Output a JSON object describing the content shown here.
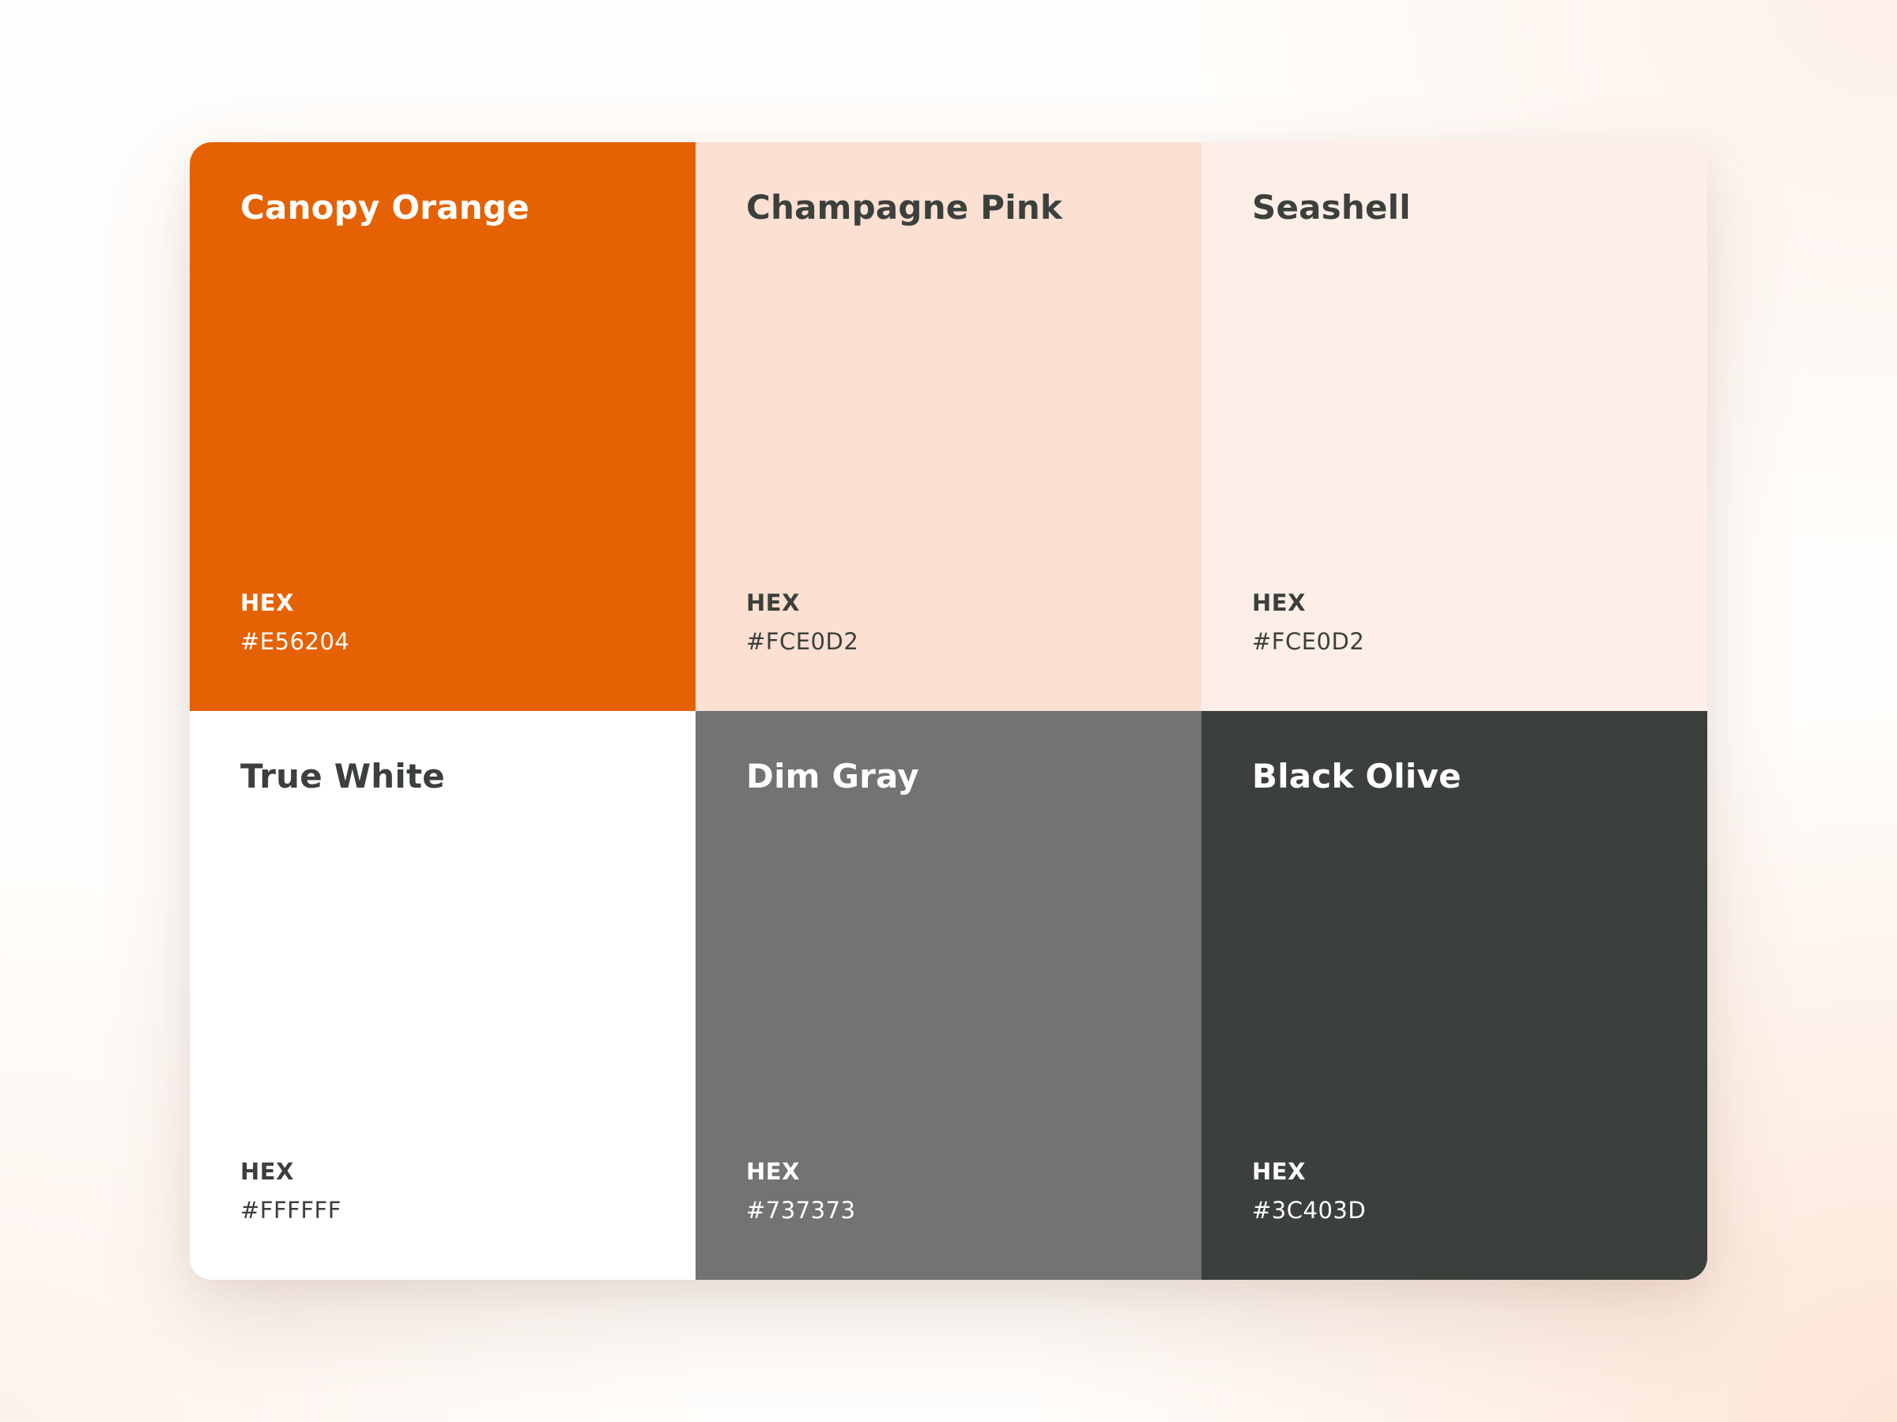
{
  "swatches": [
    {
      "name": "Canopy Orange",
      "hex_label": "HEX",
      "hex": "#E56204",
      "background": "#E56204",
      "text_color": "#FFFFFF"
    },
    {
      "name": "Champagne Pink",
      "hex_label": "HEX",
      "hex": "#FCE0D2",
      "background": "#FCE0D2",
      "text_color": "#3C403D"
    },
    {
      "name": "Seashell",
      "hex_label": "HEX",
      "hex": "#FCE0D2",
      "background": "#FDEFE7",
      "text_color": "#3C403D"
    },
    {
      "name": "True White",
      "hex_label": "HEX",
      "hex": "#FFFFFF",
      "background": "#FFFFFF",
      "text_color": "#3C403D"
    },
    {
      "name": "Dim Gray",
      "hex_label": "HEX",
      "hex": "#737373",
      "background": "#737373",
      "text_color": "#FFFFFF"
    },
    {
      "name": "Black Olive",
      "hex_label": "HEX",
      "hex": "#3C403D",
      "background": "#3C403D",
      "text_color": "#FFFFFF"
    }
  ]
}
